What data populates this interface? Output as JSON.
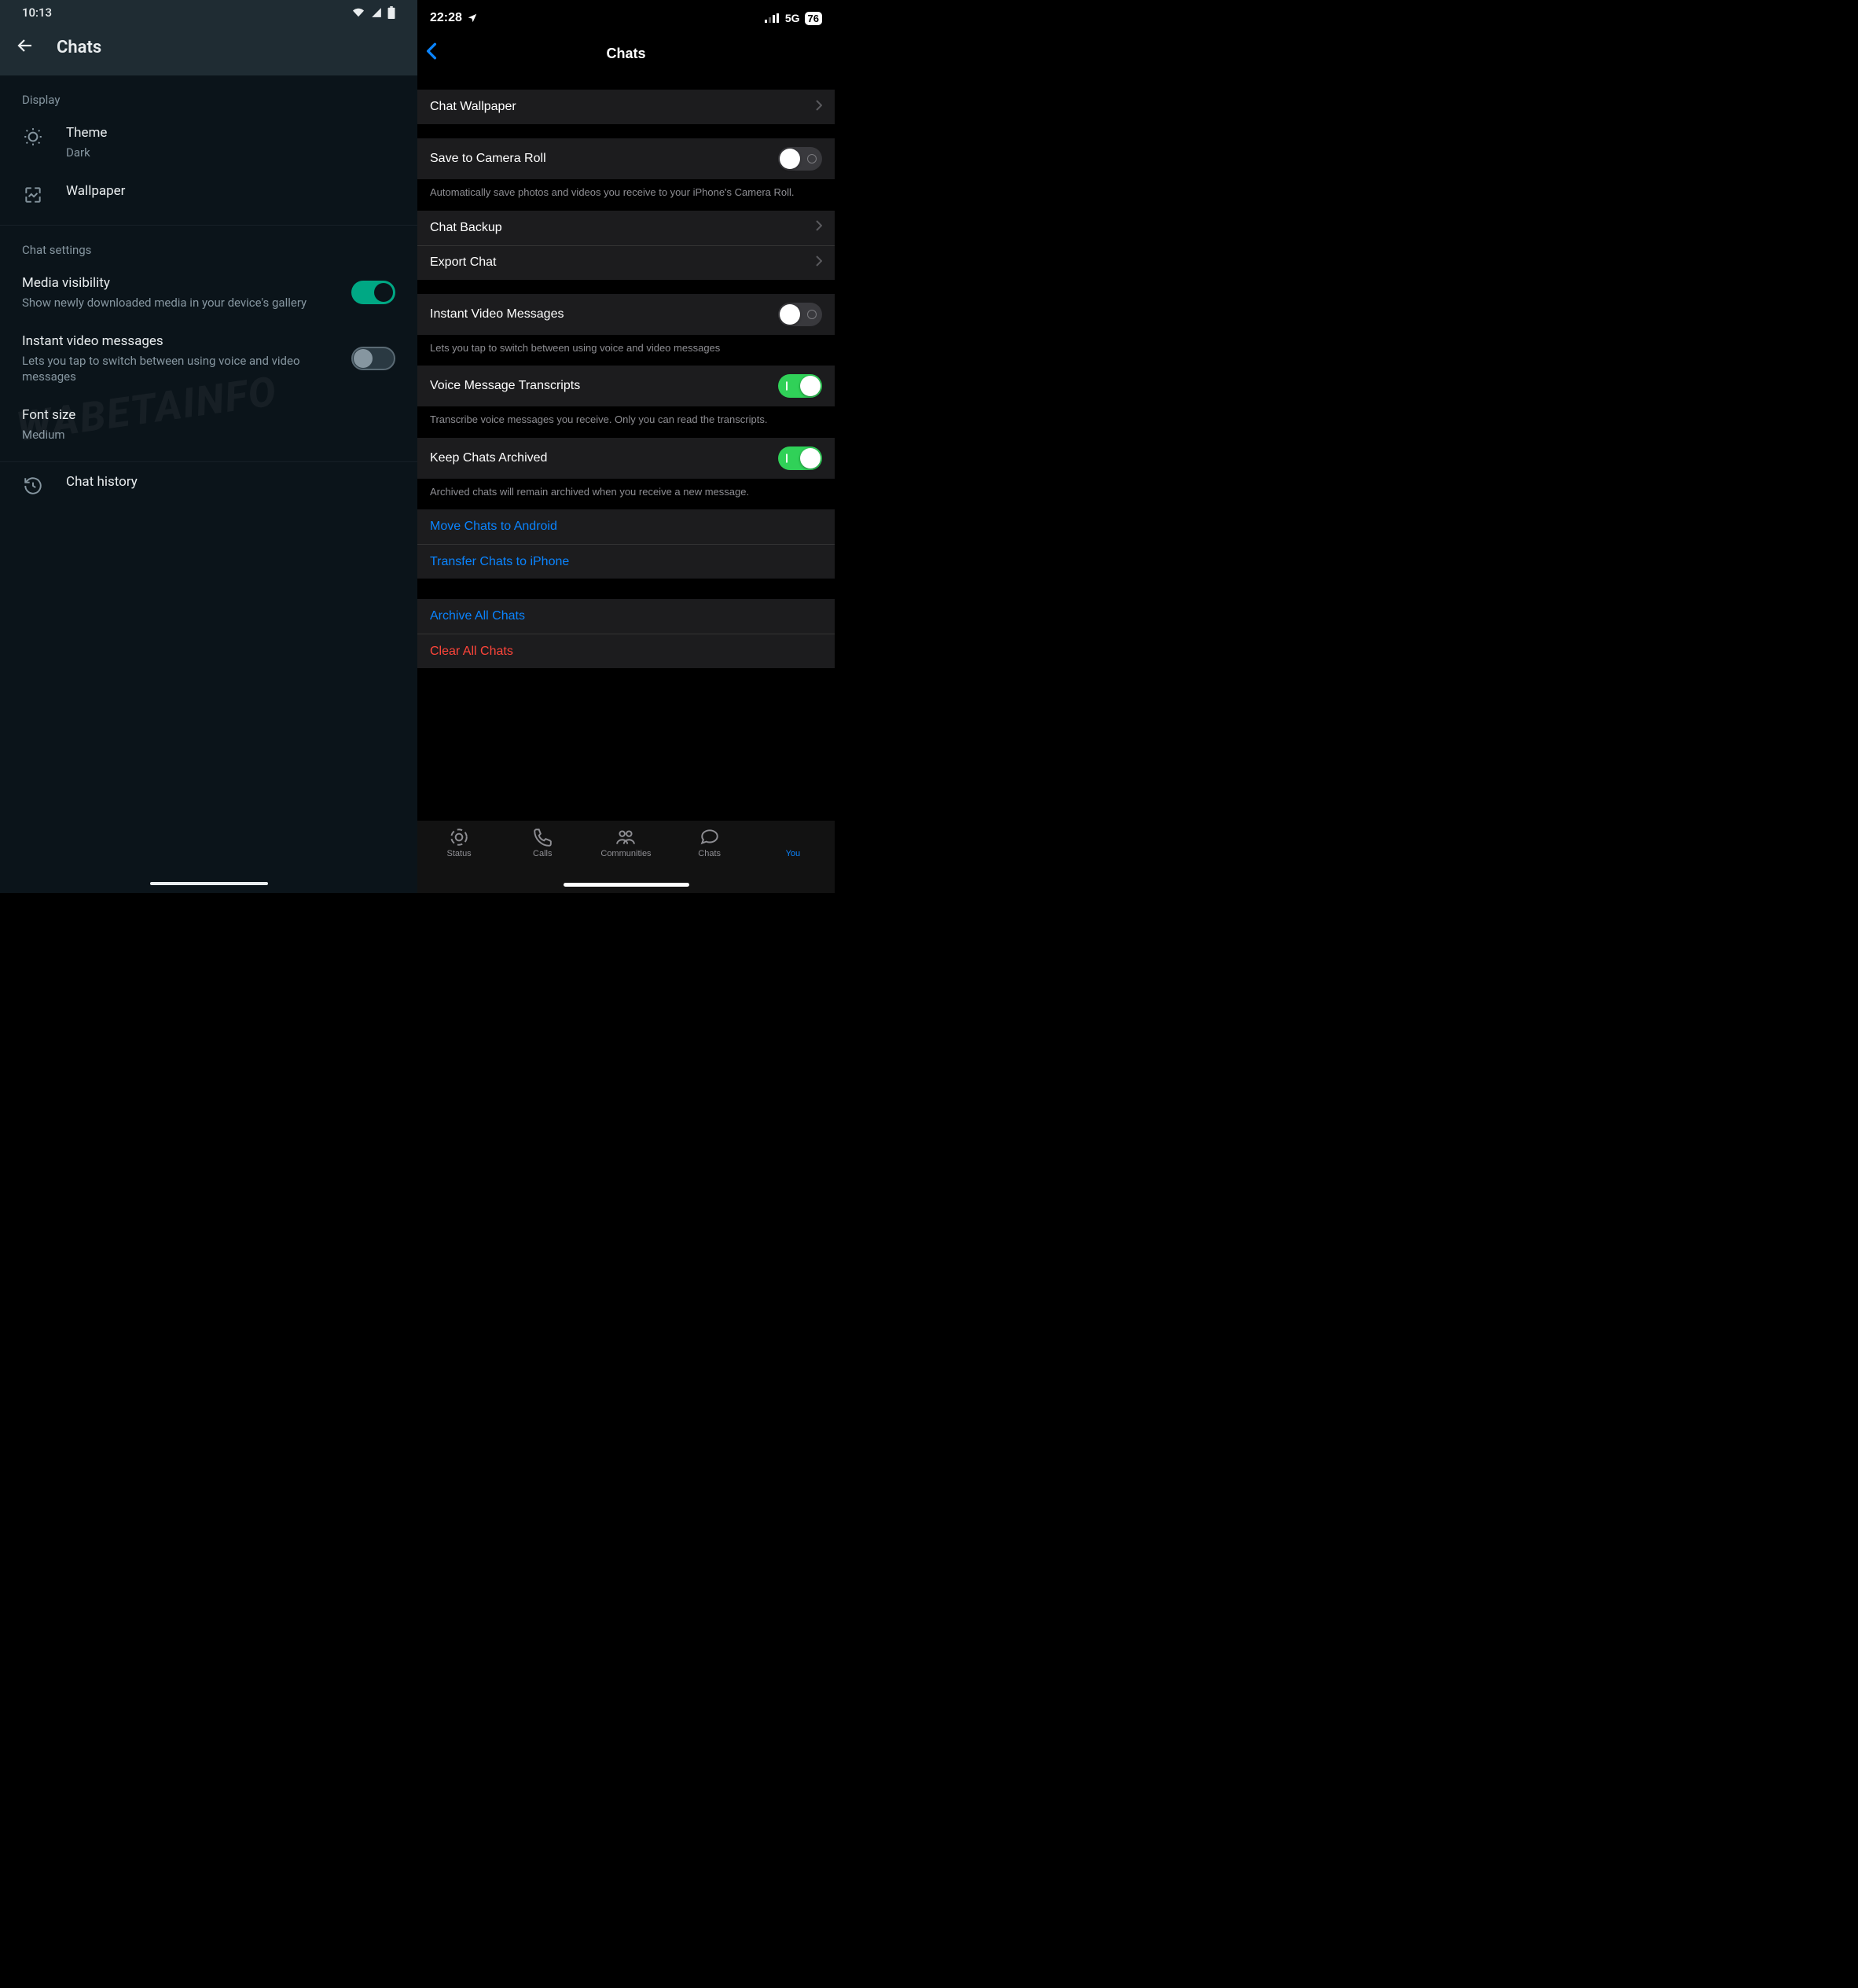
{
  "android": {
    "status": {
      "time": "10:13"
    },
    "title": "Chats",
    "sections": {
      "display": {
        "header": "Display",
        "theme": {
          "title": "Theme",
          "value": "Dark"
        },
        "wallpaper": {
          "title": "Wallpaper"
        }
      },
      "chat_settings": {
        "header": "Chat settings",
        "media_visibility": {
          "title": "Media visibility",
          "sub": "Show newly downloaded media in your device's gallery",
          "on": true
        },
        "instant_video": {
          "title": "Instant video messages",
          "sub": "Lets you tap to switch between using voice and video messages",
          "on": false
        },
        "font_size": {
          "title": "Font size",
          "value": "Medium"
        }
      },
      "chat_history": {
        "title": "Chat history"
      }
    }
  },
  "ios": {
    "status": {
      "time": "22:28",
      "network": "5G",
      "battery": "76"
    },
    "title": "Chats",
    "rows": {
      "chat_wallpaper": "Chat Wallpaper",
      "save_camera_roll": {
        "title": "Save to Camera Roll",
        "on": false,
        "footer": "Automatically save photos and videos you receive to your iPhone's Camera Roll."
      },
      "chat_backup": "Chat Backup",
      "export_chat": "Export Chat",
      "instant_video": {
        "title": "Instant Video Messages",
        "on": false,
        "footer": "Lets you tap to switch between using voice and video messages"
      },
      "voice_transcripts": {
        "title": "Voice Message Transcripts",
        "on": true,
        "footer": "Transcribe voice messages you receive. Only you can read the transcripts."
      },
      "keep_archived": {
        "title": "Keep Chats Archived",
        "on": true,
        "footer": "Archived chats will remain archived when you receive a new message."
      },
      "move_android": "Move Chats to Android",
      "transfer_iphone": "Transfer Chats to iPhone",
      "archive_all": "Archive All Chats",
      "clear_all": "Clear All Chats"
    },
    "tabs": {
      "status": "Status",
      "calls": "Calls",
      "communities": "Communities",
      "chats": "Chats",
      "you": "You"
    }
  }
}
